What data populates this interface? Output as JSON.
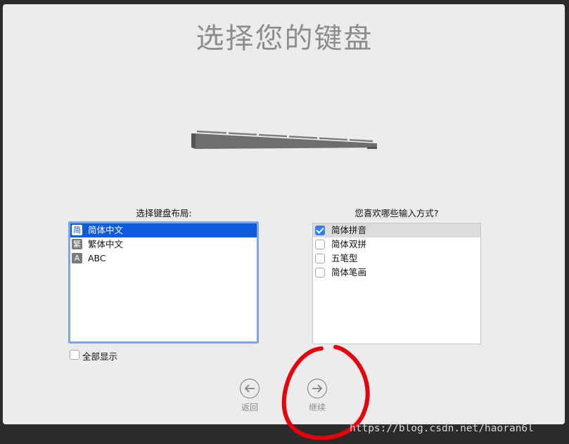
{
  "page": {
    "title": "选择您的键盘"
  },
  "layout_panel": {
    "label": "选择键盘布局:",
    "items": [
      {
        "badge": "简",
        "label": "简体中文",
        "selected": true
      },
      {
        "badge": "繁",
        "label": "繁体中文",
        "selected": false
      },
      {
        "badge": "A",
        "label": "ABC",
        "selected": false
      }
    ],
    "show_all_label": "全部显示",
    "show_all_checked": false
  },
  "input_panel": {
    "label": "您喜欢哪些输入方式?",
    "items": [
      {
        "label": "简体拼音",
        "checked": true
      },
      {
        "label": "简体双拼",
        "checked": false
      },
      {
        "label": "五笔型",
        "checked": false
      },
      {
        "label": "简体笔画",
        "checked": false
      }
    ]
  },
  "nav": {
    "back_label": "返回",
    "continue_label": "继续"
  },
  "watermark": "https://blog.csdn.net/haoran6l",
  "colors": {
    "selection": "#0b5bdc",
    "checkbox_checked": "#2f7ef5",
    "annotation": "#e8000a"
  }
}
